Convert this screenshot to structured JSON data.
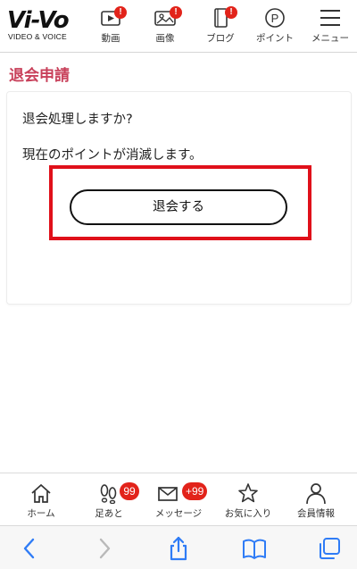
{
  "header": {
    "logo_main": "Vi-Vo",
    "logo_sub": "VIDEO & VOICE",
    "nav": [
      {
        "label": "動画",
        "icon": "video-play-icon",
        "badge": "!"
      },
      {
        "label": "画像",
        "icon": "image-icon",
        "badge": "!"
      },
      {
        "label": "ブログ",
        "icon": "blog-book-icon",
        "badge": "!"
      },
      {
        "label": "ポイント",
        "icon": "point-p-icon"
      },
      {
        "label": "メニュー",
        "icon": "hamburger-menu-icon"
      }
    ]
  },
  "page": {
    "title": "退会申請",
    "question": "退会処理しますか?",
    "note": "現在のポイントが消滅します。",
    "withdraw_label": "退会する"
  },
  "tabbar": {
    "items": [
      {
        "label": "ホーム",
        "icon": "home-icon"
      },
      {
        "label": "足あと",
        "icon": "footprints-icon",
        "badge": "99"
      },
      {
        "label": "メッセージ",
        "icon": "mail-icon",
        "badge": "+99"
      },
      {
        "label": "お気に入り",
        "icon": "star-icon"
      },
      {
        "label": "会員情報",
        "icon": "person-icon"
      }
    ]
  },
  "browser": {
    "buttons": [
      "back-chevron-icon",
      "forward-chevron-icon",
      "share-icon",
      "bookmarks-icon",
      "tabs-icon"
    ]
  },
  "colors": {
    "accent_title": "#c8405a",
    "badge_red": "#e2231a",
    "highlight_border": "#e0101a",
    "browser_blue": "#2f7cf6"
  }
}
